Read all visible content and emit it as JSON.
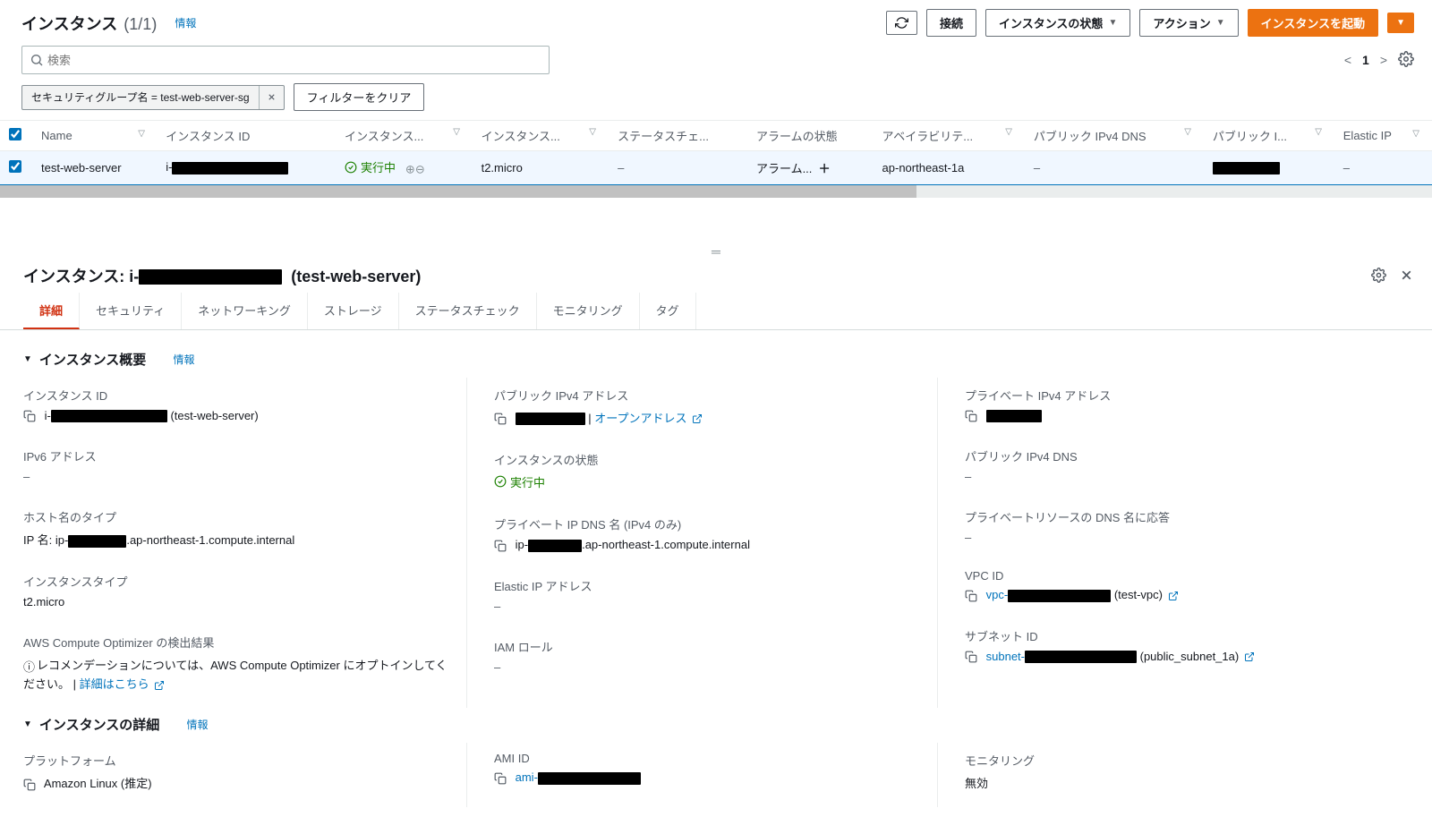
{
  "header": {
    "title": "インスタンス",
    "count": "(1/1)",
    "info": "情報",
    "buttons": {
      "refresh": "⟳",
      "connect": "接続",
      "state": "インスタンスの状態",
      "actions": "アクション",
      "launch": "インスタンスを起動"
    }
  },
  "search": {
    "placeholder": "検索"
  },
  "pager": {
    "page": "1"
  },
  "filter": {
    "chip": "セキュリティグループ名 = test-web-server-sg",
    "clear": "フィルターをクリア"
  },
  "columns": [
    "Name",
    "インスタンス ID",
    "インスタンス...",
    "インスタンス...",
    "ステータスチェ...",
    "アラームの状態",
    "アベイラビリテ...",
    "パブリック IPv4 DNS",
    "パブリック I...",
    "Elastic IP"
  ],
  "row": {
    "name": "test-web-server",
    "id_prefix": "i-",
    "state": "実行中",
    "type": "t2.micro",
    "status": "–",
    "alarm": "アラーム...",
    "plus": "＋",
    "az": "ap-northeast-1a",
    "dns": "–",
    "eip": "–"
  },
  "detail": {
    "title_prefix": "インスタンス: i-",
    "title_suffix": "(test-web-server)",
    "tabs": [
      "詳細",
      "セキュリティ",
      "ネットワーキング",
      "ストレージ",
      "ステータスチェック",
      "モニタリング",
      "タグ"
    ],
    "overview_title": "インスタンス概要",
    "details_title": "インスタンスの詳細",
    "info": "情報",
    "fields": {
      "instance_id": {
        "label": "インスタンス ID",
        "prefix": "i-",
        "suffix": "(test-web-server)"
      },
      "public_ipv4": {
        "label": "パブリック IPv4 アドレス",
        "link": "オープンアドレス"
      },
      "private_ipv4": {
        "label": "プライベート IPv4 アドレス"
      },
      "ipv6": {
        "label": "IPv6 アドレス",
        "value": "–"
      },
      "state": {
        "label": "インスタンスの状態",
        "value": "実行中"
      },
      "public_dns": {
        "label": "パブリック IPv4 DNS",
        "value": "–"
      },
      "hostname_type": {
        "label": "ホスト名のタイプ",
        "prefix": "IP 名: ip-",
        "suffix": ".ap-northeast-1.compute.internal"
      },
      "private_dns": {
        "label": "プライベート IP DNS 名 (IPv4 のみ)",
        "prefix": "ip-",
        "suffix": ".ap-northeast-1.compute.internal"
      },
      "private_resource": {
        "label": "プライベートリソースの DNS 名に応答",
        "value": "–"
      },
      "instance_type": {
        "label": "インスタンスタイプ",
        "value": "t2.micro"
      },
      "elastic_ip": {
        "label": "Elastic IP アドレス",
        "value": "–"
      },
      "vpc": {
        "label": "VPC ID",
        "prefix": "vpc-",
        "suffix": "(test-vpc)"
      },
      "optimizer": {
        "label": "AWS Compute Optimizer の検出結果",
        "text": "レコメンデーションについては、AWS Compute Optimizer にオプトインしてください。",
        "link": "詳細はこちら"
      },
      "iam": {
        "label": "IAM ロール",
        "value": "–"
      },
      "subnet": {
        "label": "サブネット ID",
        "prefix": "subnet-",
        "suffix": "(public_subnet_1a)"
      },
      "platform": {
        "label": "プラットフォーム",
        "value": "Amazon Linux (推定)"
      },
      "ami": {
        "label": "AMI ID",
        "prefix": "ami-"
      },
      "monitoring": {
        "label": "モニタリング",
        "value": "無効"
      }
    }
  }
}
